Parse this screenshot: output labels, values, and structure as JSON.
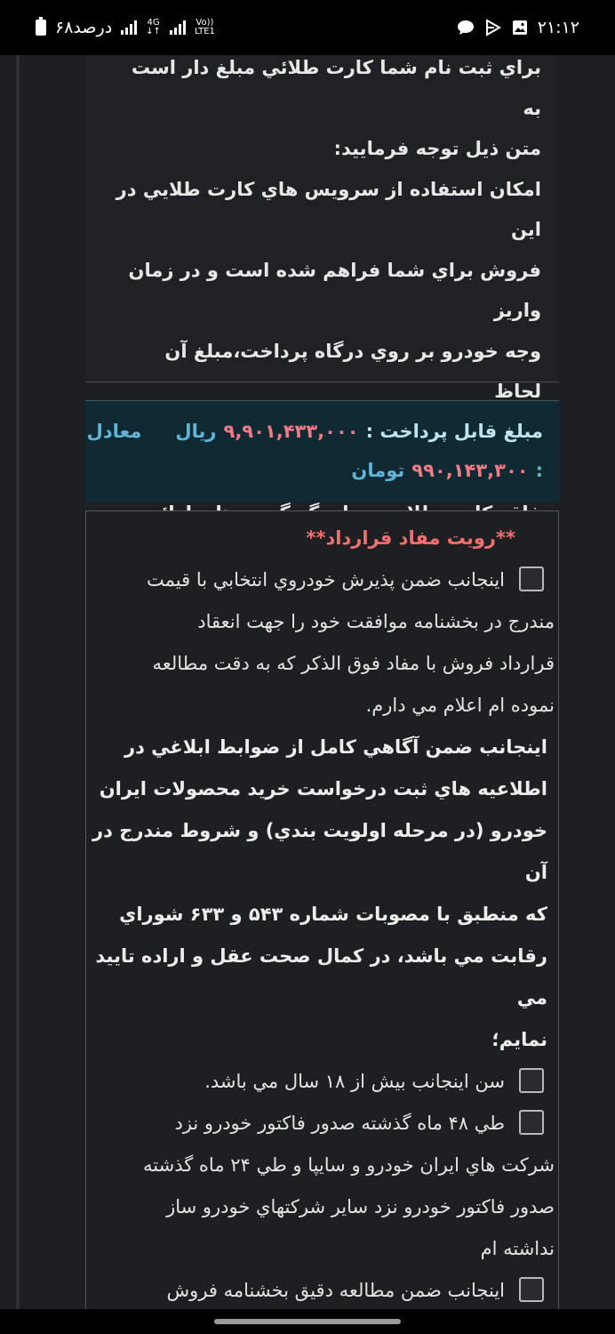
{
  "status_bar": {
    "time": "۲۱:۱۲",
    "battery_text": "۶۸درصد",
    "network_4g": "4G",
    "network_volte_top": "Vo))",
    "network_volte_bottom": "LTE1",
    "icons": [
      "gallery-icon",
      "play-icon",
      "chat-bubble-icon",
      "signal-icon",
      "battery-icon"
    ]
  },
  "intro": {
    "text": "براي ثبت نام شما كارت طلائي مبلغ دار است به\nمتن ذيل توجه فرماييد:\nامكان استفاده از سرويس هاي كارت طلايي در اين\nفروش براي شما فراهم شده است و در زمان واريز\nوجه خودرو بر روي درگاه پرداخت،مبلغ آن لحاظ\nشده است در صورت عدم تمايل،مي توانيد گزينه\nفاقد كارت طلايي و يا ديگر گزينه هاي ارائه شده را\nانتخاب نماييد."
  },
  "payment": {
    "label": "مبلغ قابل پرداخت :",
    "rial_value": "۹,۹۰۱,۴۳۳,۰۰۰",
    "rial_unit": "ريال",
    "equal_label": "معادل",
    "toman_prefix": ":",
    "toman_value": "۹۹۰,۱۴۳,۳۰۰",
    "toman_unit": "تومان"
  },
  "terms": {
    "title": "**رويت مفاد قرارداد**",
    "item1": "اينجانب ضمن پذيرش خودروي انتخابي با قيمت\nمندرج در بخشنامه موافقت خود را جهت انعقاد\nقرارداد فروش با مفاد فوق الذكر كه به دقت مطالعه\nنموده ام اعلام مي دارم.",
    "bold_declaration": "اينجانب ضمن آگاهي كامل از ضوابط ابلاغي در\nاطلاعيه هاي ثبت درخواست خريد محصولات ايران\nخودرو (در مرحله اولويت بندي) و شروط مندرج در آن\nكه منطبق با مصوبات شماره ۵۴۳ و ۶۳۳ شوراي\nرقابت مي باشد، در كمال صحت عقل و اراده تاييد مي\nنمايم؛",
    "item2": "سن اينجانب بيش از ۱۸ سال مي باشد.",
    "item3": "طي ۴۸ ماه گذشته صدور فاكتور خودرو نزد\nشركت هاي ايران خودرو و سايپا و طي ۲۴ ماه گذشته\nصدور فاكتور خودرو نزد ساير شركتهاي خودرو ساز\nنداشته ام",
    "item4": "اينجانب ضمن مطالعه دقيق بخشنامه فروش\nطرح حمايت از خانواده و جواني جمعيت با آگاهي"
  }
}
